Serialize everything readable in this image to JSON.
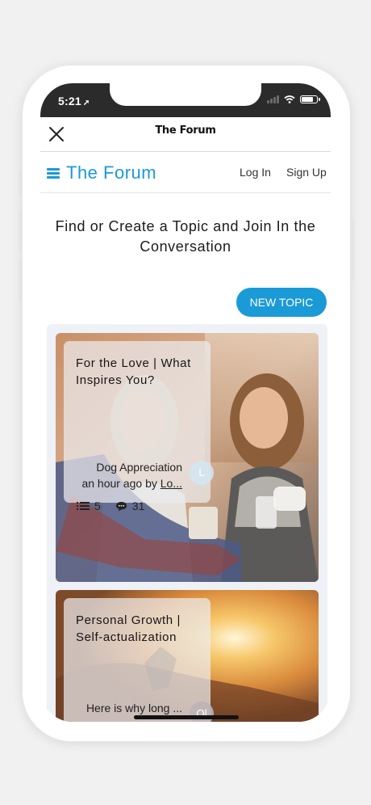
{
  "status_bar": {
    "time": "5:21",
    "location_glyph": "➚"
  },
  "app_header": {
    "title": "The Forum",
    "close_icon": "close-icon"
  },
  "nav": {
    "brand": "The Forum",
    "login": "Log In",
    "signup": "Sign Up",
    "menu_icon": "hamburger-icon"
  },
  "main": {
    "headline": "Find or Create a Topic and Join In the Conversation",
    "new_topic_label": "NEW TOPIC"
  },
  "topics": [
    {
      "title": "For the Love | What Inspires You?",
      "latest_post": "Dog Appreciation",
      "time_ago": "an hour ago by",
      "author": "Lo...",
      "avatar_initial": "L",
      "posts_count": "5",
      "comments_count": "31"
    },
    {
      "title": "Personal Growth | Self-actualization",
      "latest_post": "Here is why long ...",
      "avatar_initial": "Ol"
    }
  ],
  "colors": {
    "accent": "#1a9ad6",
    "status_bar": "#2b2b2b",
    "background": "#f1f1f2"
  }
}
